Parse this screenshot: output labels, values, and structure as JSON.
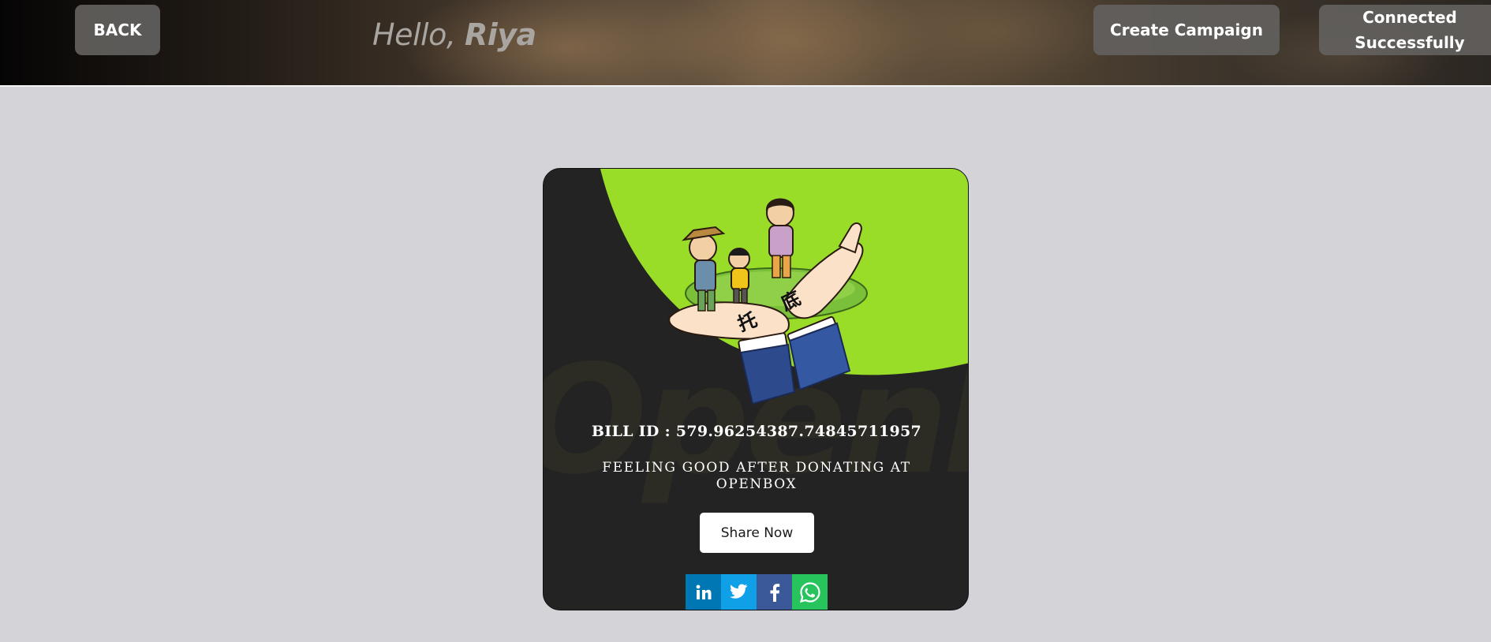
{
  "header": {
    "back_label": "BACK",
    "greeting_prefix": "Hello, ",
    "user_name": "Riya",
    "create_campaign_label": "Create Campaign",
    "connected_line1": "Connected",
    "connected_line2": "Successfully"
  },
  "card": {
    "watermark_text": "OpenB",
    "bill_id": "BILL ID : 579.96254387.74845711957",
    "message": "FEELING GOOD AFTER DONATING AT OPENBOX",
    "share_label": "Share Now",
    "social_icons": [
      "linkedin-icon",
      "twitter-icon",
      "facebook-icon",
      "whatsapp-icon"
    ],
    "illustration_glyphs": [
      "托",
      "底"
    ]
  },
  "colors": {
    "page_bg": "#d4d3d8",
    "card_bg": "#232323",
    "accent_green": "#9add28",
    "linkedin": "#0077b5",
    "twitter": "#10a0e8",
    "facebook": "#3b5998",
    "whatsapp": "#27c35c"
  }
}
